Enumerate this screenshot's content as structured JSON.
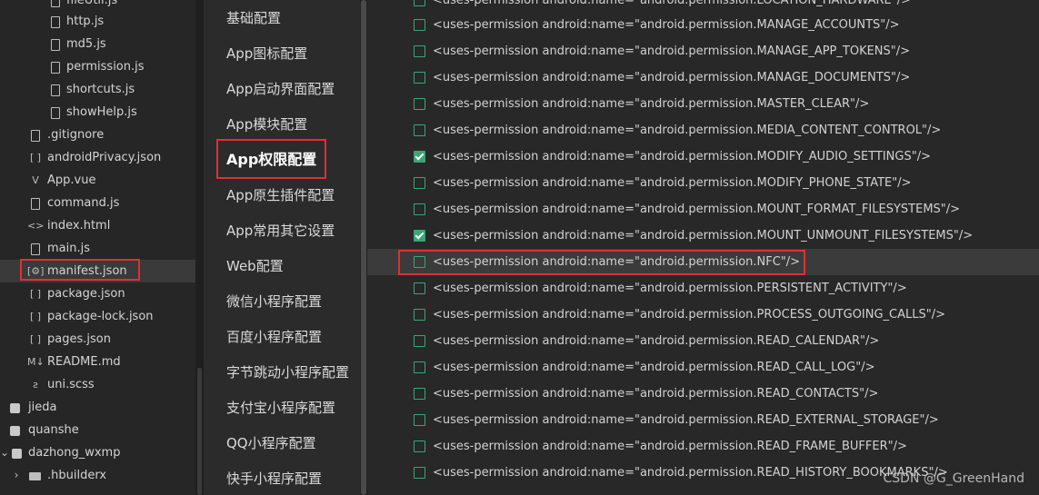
{
  "file_tree": {
    "items": [
      {
        "label": "fileUtil.js",
        "icon": "file-icon"
      },
      {
        "label": "http.js",
        "icon": "file-icon"
      },
      {
        "label": "md5.js",
        "icon": "file-icon"
      },
      {
        "label": "permission.js",
        "icon": "file-icon"
      },
      {
        "label": "shortcuts.js",
        "icon": "file-icon"
      },
      {
        "label": "showHelp.js",
        "icon": "file-icon"
      },
      {
        "label": ".gitignore",
        "icon": "file-icon"
      },
      {
        "label": "androidPrivacy.json",
        "icon": "json-icon",
        "glyph": "[ ]"
      },
      {
        "label": "App.vue",
        "icon": "vue-icon",
        "glyph": "V"
      },
      {
        "label": "command.js",
        "icon": "file-icon"
      },
      {
        "label": "index.html",
        "icon": "html-icon",
        "glyph": "<>"
      },
      {
        "label": "main.js",
        "icon": "file-icon"
      },
      {
        "label": "manifest.json",
        "icon": "manifest-icon",
        "glyph": "[⚙]",
        "selected": true
      },
      {
        "label": "package.json",
        "icon": "json-icon",
        "glyph": "[ ]"
      },
      {
        "label": "package-lock.json",
        "icon": "json-icon",
        "glyph": "[ ]"
      },
      {
        "label": "pages.json",
        "icon": "json-icon",
        "glyph": "[ ]"
      },
      {
        "label": "README.md",
        "icon": "markdown-icon",
        "glyph": "M↓"
      },
      {
        "label": "uni.scss",
        "icon": "scss-icon",
        "glyph": "ꙅ"
      },
      {
        "label": "jieda",
        "icon": "project-icon"
      },
      {
        "label": "quanshe",
        "icon": "project-icon"
      },
      {
        "label": "dazhong_wxmp",
        "icon": "project-icon",
        "expanded": true
      },
      {
        "label": ".hbuilderx",
        "icon": "folder-icon"
      }
    ]
  },
  "config_nav": {
    "items": [
      {
        "label": "基础配置"
      },
      {
        "label": "App图标配置"
      },
      {
        "label": "App启动界面配置"
      },
      {
        "label": "App模块配置"
      },
      {
        "label": "App权限配置",
        "active": true
      },
      {
        "label": "App原生插件配置"
      },
      {
        "label": "App常用其它设置"
      },
      {
        "label": "Web配置"
      },
      {
        "label": "微信小程序配置"
      },
      {
        "label": "百度小程序配置"
      },
      {
        "label": "字节跳动小程序配置"
      },
      {
        "label": "支付宝小程序配置"
      },
      {
        "label": "QQ小程序配置"
      },
      {
        "label": "快手小程序配置"
      }
    ]
  },
  "permissions": {
    "items": [
      {
        "text": "<uses-permission android:name=\"android.permission.LOCATION_HARDWARE\"/>",
        "checked": false
      },
      {
        "text": "<uses-permission android:name=\"android.permission.MANAGE_ACCOUNTS\"/>",
        "checked": false
      },
      {
        "text": "<uses-permission android:name=\"android.permission.MANAGE_APP_TOKENS\"/>",
        "checked": false
      },
      {
        "text": "<uses-permission android:name=\"android.permission.MANAGE_DOCUMENTS\"/>",
        "checked": false
      },
      {
        "text": "<uses-permission android:name=\"android.permission.MASTER_CLEAR\"/>",
        "checked": false
      },
      {
        "text": "<uses-permission android:name=\"android.permission.MEDIA_CONTENT_CONTROL\"/>",
        "checked": false
      },
      {
        "text": "<uses-permission android:name=\"android.permission.MODIFY_AUDIO_SETTINGS\"/>",
        "checked": true
      },
      {
        "text": "<uses-permission android:name=\"android.permission.MODIFY_PHONE_STATE\"/>",
        "checked": false
      },
      {
        "text": "<uses-permission android:name=\"android.permission.MOUNT_FORMAT_FILESYSTEMS\"/>",
        "checked": false
      },
      {
        "text": "<uses-permission android:name=\"android.permission.MOUNT_UNMOUNT_FILESYSTEMS\"/>",
        "checked": true
      },
      {
        "text": "<uses-permission android:name=\"android.permission.NFC\"/>",
        "checked": false,
        "highlighted": true
      },
      {
        "text": "<uses-permission android:name=\"android.permission.PERSISTENT_ACTIVITY\"/>",
        "checked": false
      },
      {
        "text": "<uses-permission android:name=\"android.permission.PROCESS_OUTGOING_CALLS\"/>",
        "checked": false
      },
      {
        "text": "<uses-permission android:name=\"android.permission.READ_CALENDAR\"/>",
        "checked": false
      },
      {
        "text": "<uses-permission android:name=\"android.permission.READ_CALL_LOG\"/>",
        "checked": false
      },
      {
        "text": "<uses-permission android:name=\"android.permission.READ_CONTACTS\"/>",
        "checked": false
      },
      {
        "text": "<uses-permission android:name=\"android.permission.READ_EXTERNAL_STORAGE\"/>",
        "checked": false
      },
      {
        "text": "<uses-permission android:name=\"android.permission.READ_FRAME_BUFFER\"/>",
        "checked": false
      },
      {
        "text": "<uses-permission android:name=\"android.permission.READ_HISTORY_BOOKMARKS\"/>",
        "checked": false
      }
    ]
  },
  "watermark": "CSDN @G_GreenHand",
  "colors": {
    "checkbox": "#3aa676",
    "annotation": "#e03030"
  }
}
